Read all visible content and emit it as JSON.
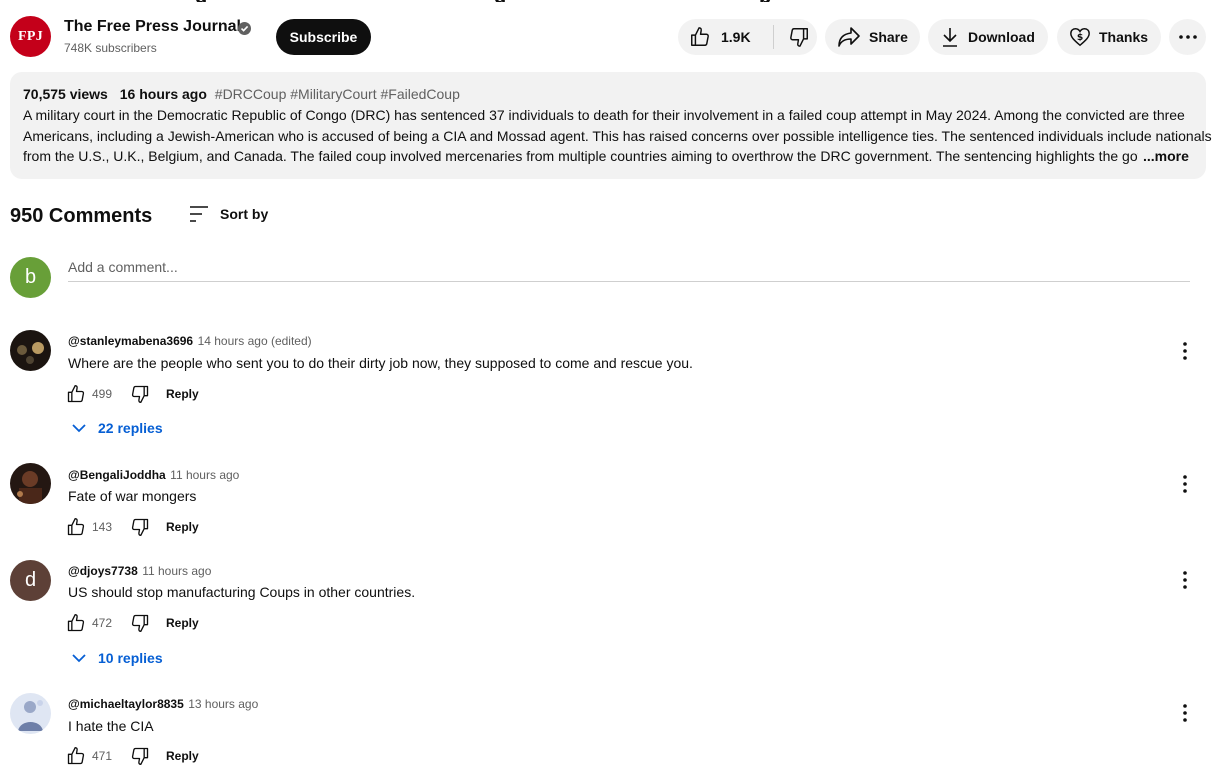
{
  "video": {
    "title_fragment_1": "g",
    "title_fragment_2": "g",
    "title_fragment_3": "p"
  },
  "channel": {
    "logo_text": "FPJ",
    "name": "The Free Press Journal",
    "subscribers": "748K subscribers",
    "subscribe_label": "Subscribe",
    "brand_color": "#c4001a"
  },
  "actions": {
    "like_count": "1.9K",
    "share_label": "Share",
    "download_label": "Download",
    "thanks_label": "Thanks"
  },
  "description": {
    "views": "70,575 views",
    "time": "16 hours ago",
    "hashtags": "#DRCCoup #MilitaryCourt #FailedCoup",
    "line1": "A military court in the Democratic Republic of Congo (DRC) has sentenced 37 individuals to death for their involvement in a failed coup attempt in May 2024. Among the convicted are three",
    "line2": "Americans, including a Jewish-American who is accused of being a CIA and Mossad agent. This has raised concerns over possible intelligence ties. The sentenced individuals include nationals",
    "line3": "from the U.S., U.K., Belgium, and Canada. The failed coup involved mercenaries from multiple countries aiming to overthrow the DRC government. The sentencing highlights the gover",
    "more_label": "...more"
  },
  "comments_header": {
    "count": "950 Comments",
    "sort_label": "Sort by"
  },
  "composer": {
    "avatar_letter": "b",
    "placeholder": "Add a comment..."
  },
  "comments": [
    {
      "author": "@stanleymabena3696",
      "time": "14 hours ago (edited)",
      "text": "Where are the people who sent you to do their dirty job now, they supposed to come and rescue you.",
      "likes": "499",
      "reply_label": "Reply",
      "replies": "22 replies"
    },
    {
      "author": "@BengaliJoddha",
      "time": "11 hours ago",
      "text": "Fate of war mongers",
      "likes": "143",
      "reply_label": "Reply"
    },
    {
      "author": "@djoys7738",
      "time": "11 hours ago",
      "avatar_letter": "d",
      "text": "US should stop manufacturing Coups in other countries.",
      "likes": "472",
      "reply_label": "Reply",
      "replies": "10 replies"
    },
    {
      "author": "@michaeltaylor8835",
      "time": "13 hours ago",
      "text": "I hate the CIA",
      "likes": "471",
      "reply_label": "Reply"
    }
  ]
}
